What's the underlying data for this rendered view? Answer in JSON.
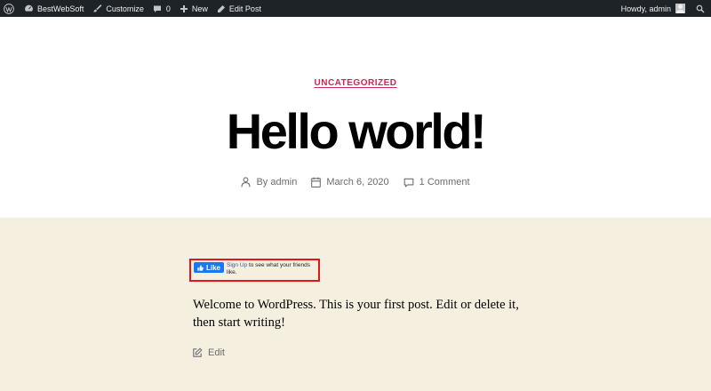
{
  "adminbar": {
    "site_name": "BestWebSoft",
    "customize": "Customize",
    "comments_count": "0",
    "new": "New",
    "edit_post": "Edit Post",
    "howdy": "Howdy, admin",
    "icons": [
      "wordpress-logo-icon",
      "dashboard-icon",
      "brush-icon",
      "comment-icon",
      "plus-icon",
      "pencil-icon",
      "avatar",
      "search-icon"
    ]
  },
  "post": {
    "category": "UNCATEGORIZED",
    "title": "Hello world!",
    "author_prefix": "By",
    "author": "admin",
    "date": "March 6, 2020",
    "comments": "1 Comment",
    "content": "Welcome to WordPress. This is your first post. Edit or delete it, then start writing!",
    "edit": "Edit"
  },
  "facebook": {
    "like_label": "Like",
    "sign_up": "Sign Up",
    "message": " to see what your friends like."
  },
  "colors": {
    "adminbar_bg": "#1d2327",
    "accent": "#cd2653",
    "content_bg": "#f5efe0",
    "fb_blue": "#1877f2",
    "highlight_border": "#e8141b"
  }
}
